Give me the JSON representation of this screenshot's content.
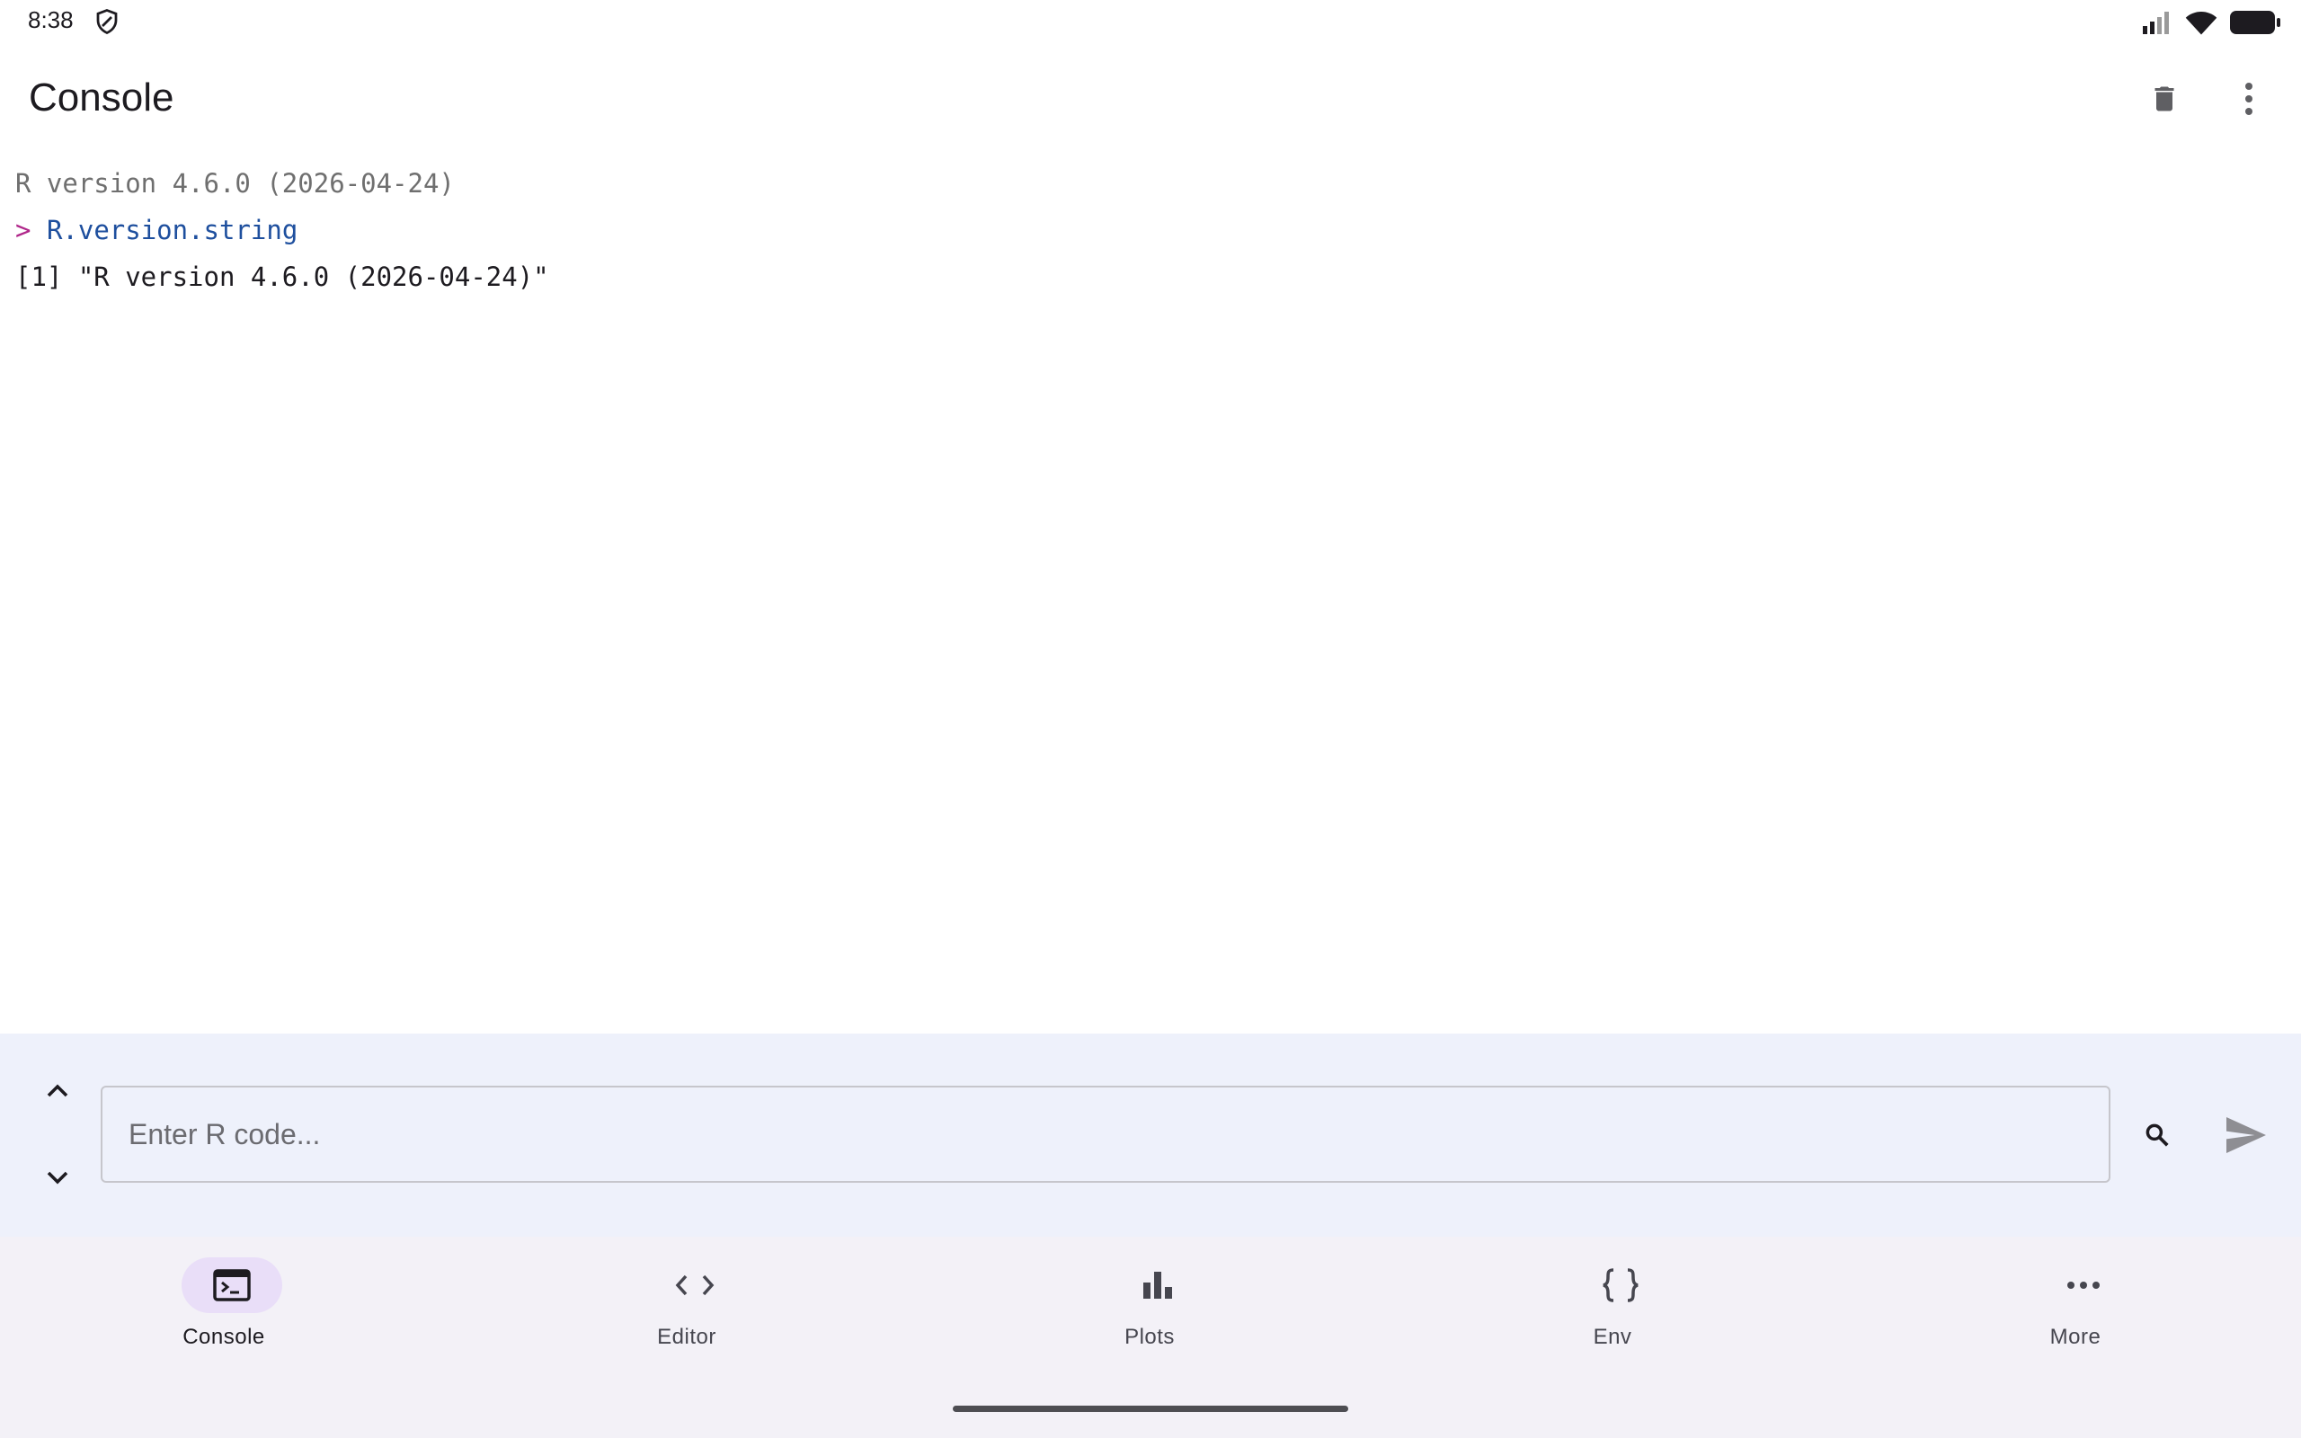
{
  "status_bar": {
    "time": "8:38",
    "left_icons": [
      "shield-icon"
    ],
    "right_icons": [
      "cellular-signal-icon",
      "wifi-icon",
      "battery-icon"
    ]
  },
  "app_bar": {
    "title": "Console",
    "actions": [
      "trash-icon",
      "more-vert-icon"
    ]
  },
  "console": {
    "banner": "R version 4.6.0 (2026-04-24)",
    "prompt": ">",
    "command": "R.version.string",
    "result": "[1] \"R version 4.6.0 (2026-04-24)\""
  },
  "input": {
    "placeholder": "Enter R code...",
    "value": ""
  },
  "bottom_nav": {
    "items": [
      {
        "label": "Console",
        "icon": "terminal-icon",
        "active": true
      },
      {
        "label": "Editor",
        "icon": "code-icon",
        "active": false
      },
      {
        "label": "Plots",
        "icon": "bar-chart-icon",
        "active": false
      },
      {
        "label": "Env",
        "icon": "braces-icon",
        "active": false
      },
      {
        "label": "More",
        "icon": "more-horiz-icon",
        "active": false
      }
    ]
  },
  "colors": {
    "prompt": "#b0278a",
    "command": "#1e4f9e",
    "input_panel_bg": "#eef1fb",
    "nav_bg": "#f3f1f7",
    "active_pill": "#e9def8"
  }
}
